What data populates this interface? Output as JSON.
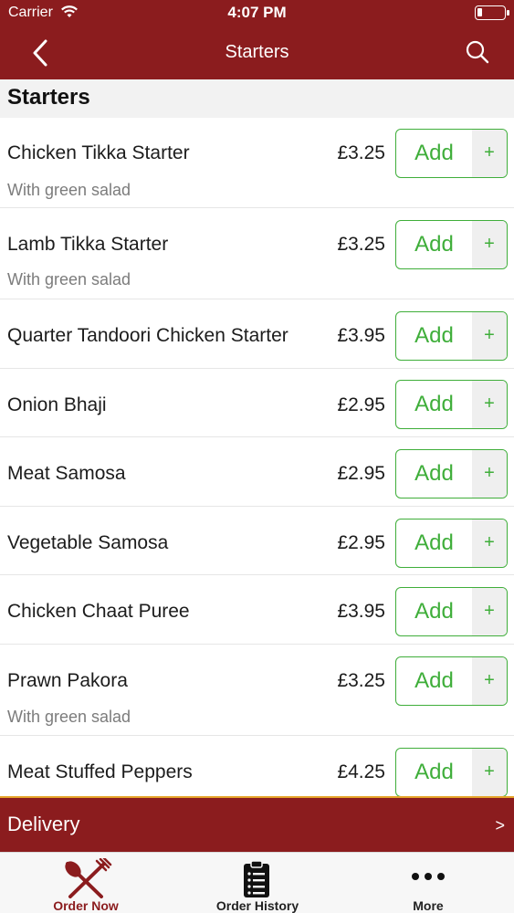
{
  "status_bar": {
    "carrier": "Carrier",
    "time": "4:07 PM"
  },
  "nav": {
    "title": "Starters",
    "back_icon": "chevron-left-icon",
    "search_icon": "search-icon"
  },
  "section": {
    "title": "Starters"
  },
  "items": [
    {
      "name": "Chicken Tikka Starter",
      "description": "With green salad",
      "price": "£3.25",
      "add_label": "Add",
      "plus_label": "+"
    },
    {
      "name": "Lamb Tikka Starter",
      "description": "With green salad",
      "price": "£3.25",
      "add_label": "Add",
      "plus_label": "+"
    },
    {
      "name": "Quarter Tandoori Chicken Starter",
      "description": "",
      "price": "£3.95",
      "add_label": "Add",
      "plus_label": "+"
    },
    {
      "name": "Onion Bhaji",
      "description": "",
      "price": "£2.95",
      "add_label": "Add",
      "plus_label": "+"
    },
    {
      "name": "Meat Samosa",
      "description": "",
      "price": "£2.95",
      "add_label": "Add",
      "plus_label": "+"
    },
    {
      "name": "Vegetable Samosa",
      "description": "",
      "price": "£2.95",
      "add_label": "Add",
      "plus_label": "+"
    },
    {
      "name": "Chicken Chaat Puree",
      "description": "",
      "price": "£3.95",
      "add_label": "Add",
      "plus_label": "+"
    },
    {
      "name": "Prawn Pakora",
      "description": "With green salad",
      "price": "£3.25",
      "add_label": "Add",
      "plus_label": "+"
    },
    {
      "name": "Meat Stuffed Peppers",
      "description": "",
      "price": "£4.25",
      "add_label": "Add",
      "plus_label": "+"
    }
  ],
  "delivery": {
    "label": "Delivery",
    "chevron": ">"
  },
  "tabs": [
    {
      "label": "Order Now",
      "icon": "fork-knife-icon",
      "active": true
    },
    {
      "label": "Order History",
      "icon": "clipboard-icon",
      "active": false
    },
    {
      "label": "More",
      "icon": "more-dots-icon",
      "active": false
    }
  ],
  "colors": {
    "brand": "#8b1c1e",
    "accent_green": "#3fae3a",
    "delivery_border": "#e6a52b"
  }
}
